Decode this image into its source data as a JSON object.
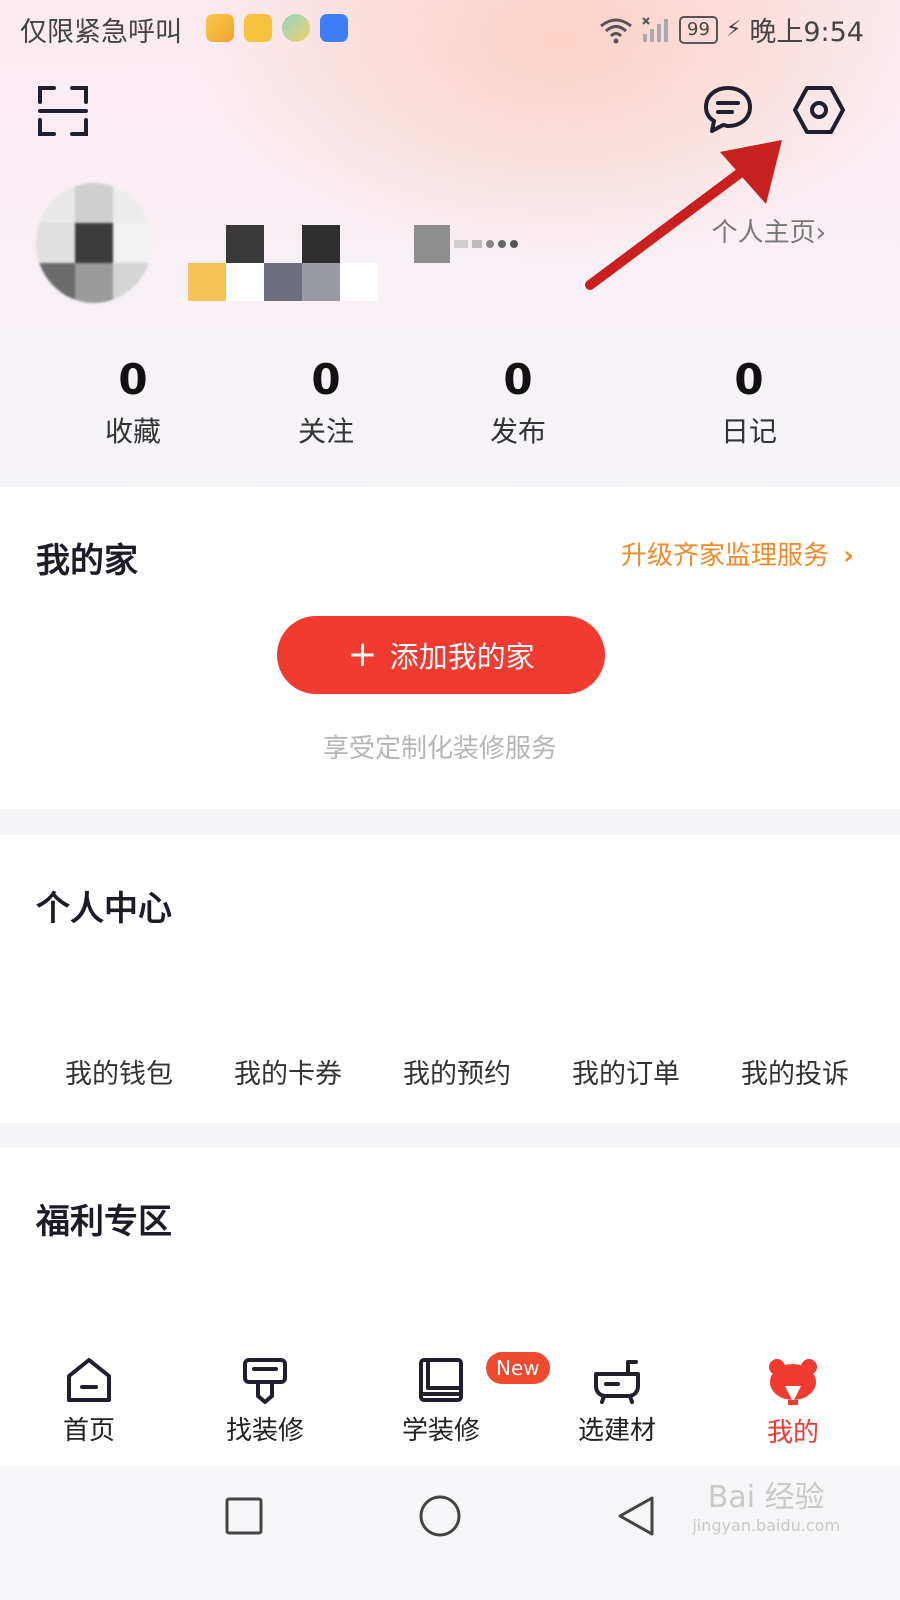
{
  "status_bar": {
    "carrier_text": "仅限紧急呼叫",
    "battery": "99",
    "time": "晚上9:54"
  },
  "header": {
    "scan_icon": "scan-icon",
    "message_icon": "chat-bubble-icon",
    "settings_icon": "settings-hexagon-icon",
    "profile_link": "个人主页",
    "profile_link_chevron": "›"
  },
  "stats": [
    {
      "value": "0",
      "label": "收藏"
    },
    {
      "value": "0",
      "label": "关注"
    },
    {
      "value": "0",
      "label": "发布"
    },
    {
      "value": "0",
      "label": "日记"
    }
  ],
  "my_home": {
    "title": "我的家",
    "upgrade_link": "升级齐家监理服务",
    "upgrade_chevron": "›",
    "add_button": "添加我的家",
    "hint": "享受定制化装修服务"
  },
  "personal_center": {
    "title": "个人中心",
    "items": [
      "我的钱包",
      "我的卡券",
      "我的预约",
      "我的订单",
      "我的投诉"
    ]
  },
  "welfare": {
    "title": "福利专区"
  },
  "tab_bar": {
    "tabs": [
      {
        "label": "首页",
        "icon": "home-icon"
      },
      {
        "label": "找装修",
        "icon": "paint-roller-icon"
      },
      {
        "label": "学装修",
        "icon": "book-icon"
      },
      {
        "label": "选建材",
        "icon": "bathtub-icon"
      },
      {
        "label": "我的",
        "icon": "bear-icon"
      }
    ],
    "new_badge": "New",
    "active_color": "#f13a30"
  },
  "watermark": {
    "main": "Bai 经验",
    "url": "jingyan.baidu.com"
  },
  "colors": {
    "primary_red": "#f13a30",
    "orange_link": "#f08a2b",
    "annotation_arrow": "#c8201e"
  }
}
